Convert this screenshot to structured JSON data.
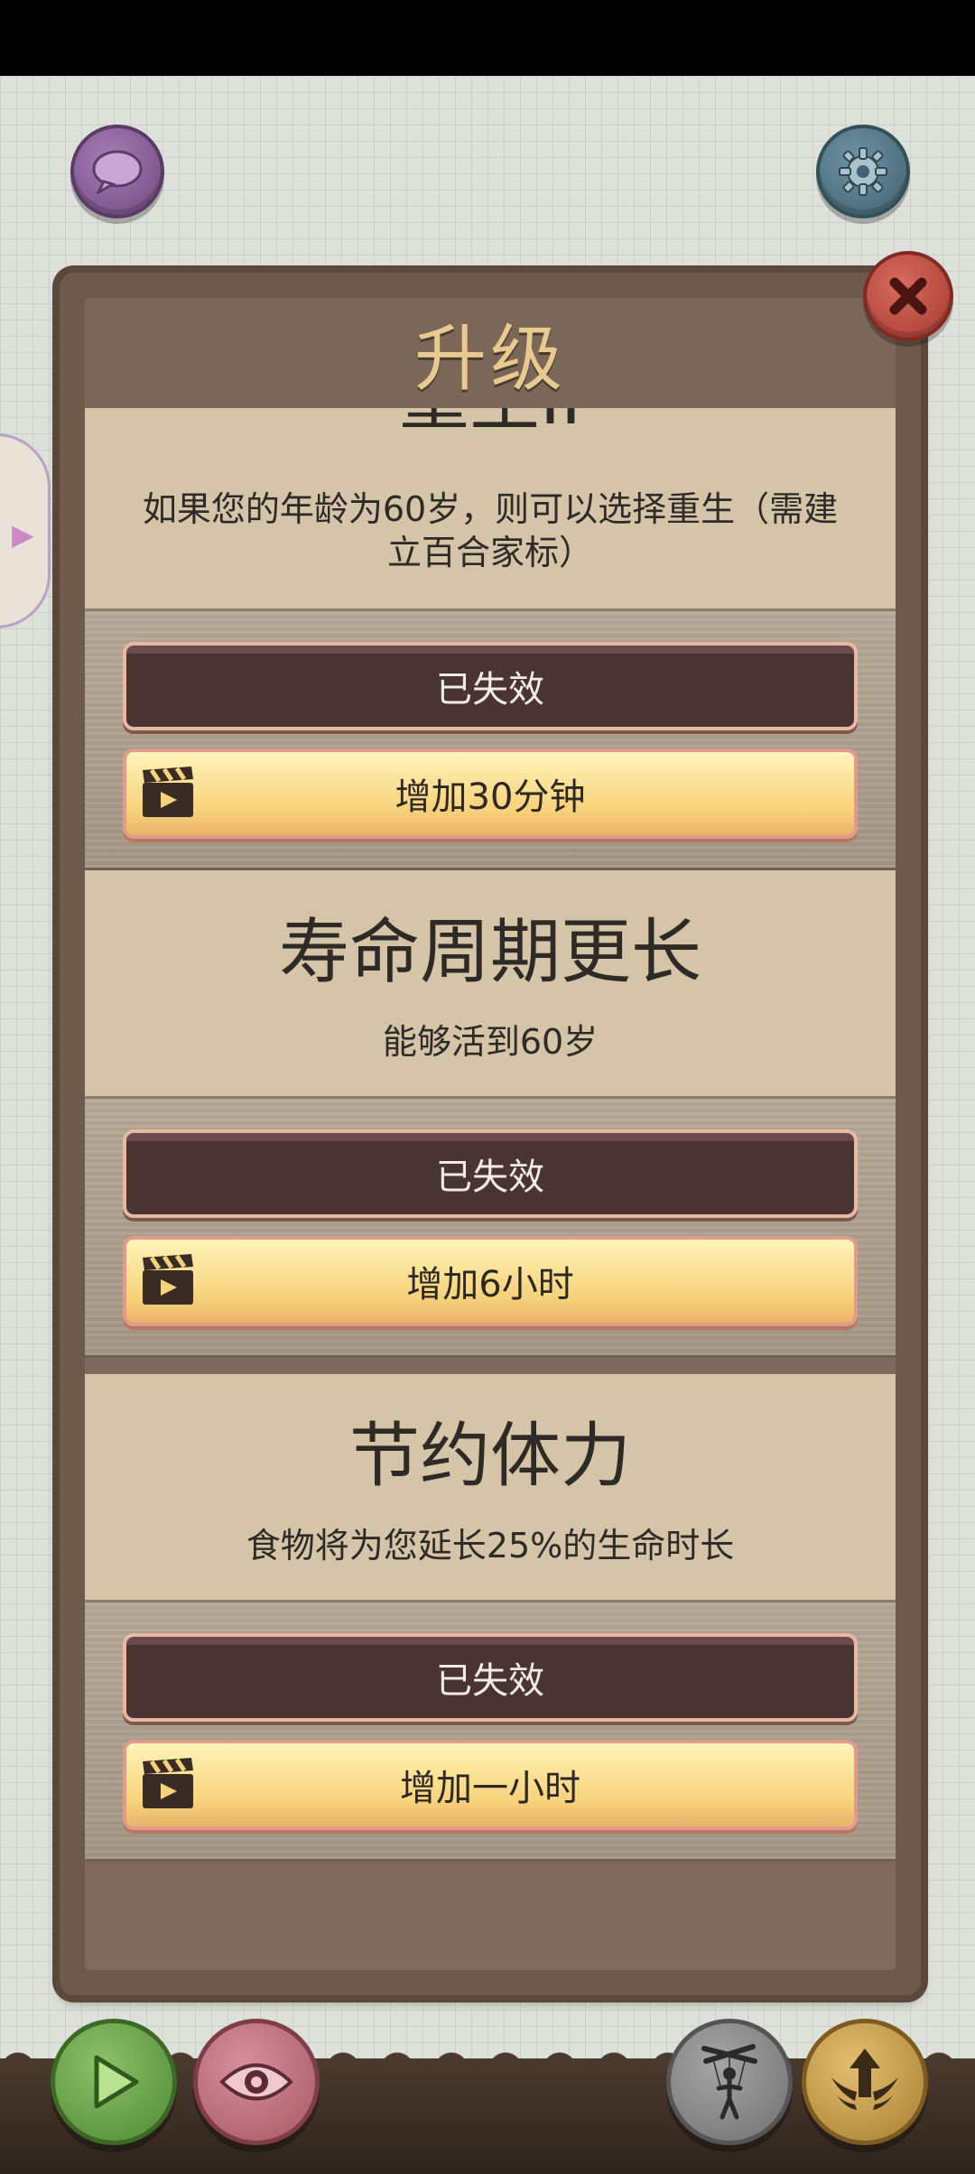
{
  "panel": {
    "title": "升级"
  },
  "sections": [
    {
      "title": "重生II",
      "description": "如果您的年龄为60岁，则可以选择重生（需建立百合家标）",
      "desc_line1": "如果您的年龄为60岁，则可以选择重生（需建",
      "desc_line2": "立百合家标）",
      "status_label": "已失效",
      "video_label": "增加30分钟"
    },
    {
      "title": "寿命周期更长",
      "description": "能够活到60岁",
      "status_label": "已失效",
      "video_label": "增加6小时"
    },
    {
      "title": "节约体力",
      "description": "食物将为您延长25%的生命时长",
      "status_label": "已失效",
      "video_label": "增加一小时"
    }
  ],
  "icons": {
    "chat": "chat-bubble-icon",
    "settings": "gear-icon",
    "close": "close-icon",
    "video": "clapperboard-icon",
    "play": "play-icon",
    "view": "eye-icon",
    "puppet": "puppet-icon",
    "upgrade": "winged-arrow-icon"
  },
  "colors": {
    "panel_frame": "#6e5a4b",
    "title_text": "#e8c98f",
    "expired_button": "#4a3333",
    "video_button": "#f7d27a"
  }
}
